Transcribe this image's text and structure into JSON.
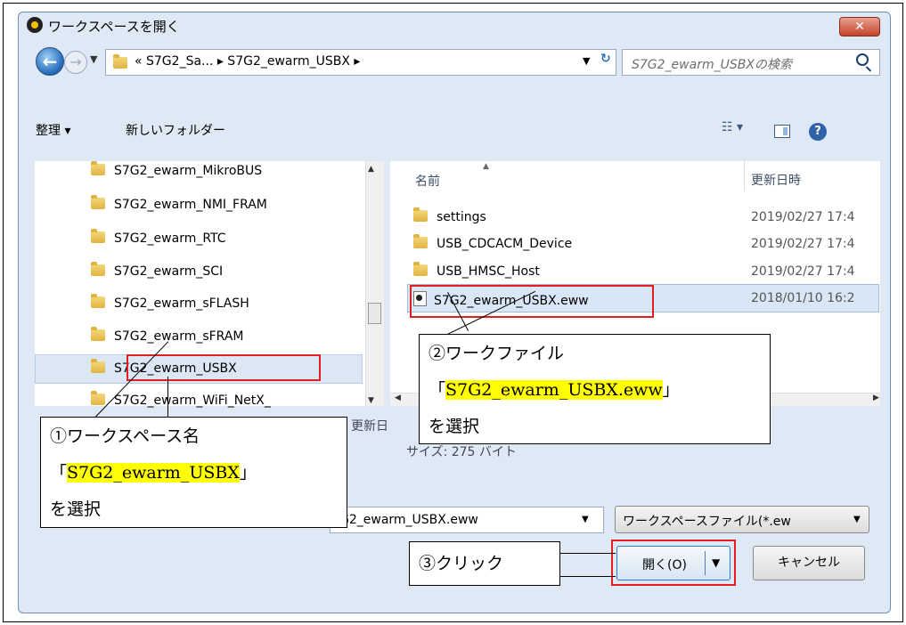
{
  "dialog": {
    "title": "ワークスペースを開く",
    "close_label": "✕"
  },
  "address": {
    "path": "«  S7G2_Sa...  ▸  S7G2_ewarm_USBX  ▸",
    "search_placeholder": "S7G2_ewarm_USBXの検索"
  },
  "toolbar": {
    "organize": "整理 ▾",
    "new_folder": "新しいフォルダー",
    "view_label": "☷ ▾"
  },
  "tree": {
    "items": [
      "S7G2_ewarm_MikroBUS",
      "S7G2_ewarm_NMI_FRAM",
      "S7G2_ewarm_RTC",
      "S7G2_ewarm_SCI",
      "S7G2_ewarm_sFLASH",
      "S7G2_ewarm_sFRAM",
      "S7G2_ewarm_USBX",
      "S7G2_ewarm_WiFi_NetX_"
    ]
  },
  "files": {
    "col_name": "名前",
    "col_date": "更新日時",
    "rows": [
      {
        "name": "settings",
        "date": "2019/02/27 17:4"
      },
      {
        "name": "USB_CDCACM_Device",
        "date": "2019/02/27 17:4"
      },
      {
        "name": "USB_HMSC_Host",
        "date": "2019/02/27 17:4"
      },
      {
        "name": "S7G2_ewarm_USBX.eww",
        "date": "2018/01/10 16:2"
      }
    ]
  },
  "info": {
    "date_label": "更新日",
    "size_label": "サイズ: 275 バイト"
  },
  "bottom": {
    "filename": "G2_ewarm_USBX.eww",
    "filetype": "ワークスペースファイル(*.ew",
    "open_label": "開く(O)",
    "cancel_label": "キャンセル"
  },
  "annotations": {
    "c1_line1": "①ワークスペース名",
    "c1_open": "「",
    "c1_name": "S7G2_ewarm_USBX",
    "c1_close": "」",
    "c1_line3": "を選択",
    "c2_line1": "②ワークファイル",
    "c2_open": "「",
    "c2_name": "S7G2_ewarm_USBX.eww",
    "c2_close": "」",
    "c2_line3": "を選択",
    "c3": "③クリック"
  },
  "colors": {
    "highlight_red": "#e02020",
    "marker_yellow": "#ffff00"
  }
}
